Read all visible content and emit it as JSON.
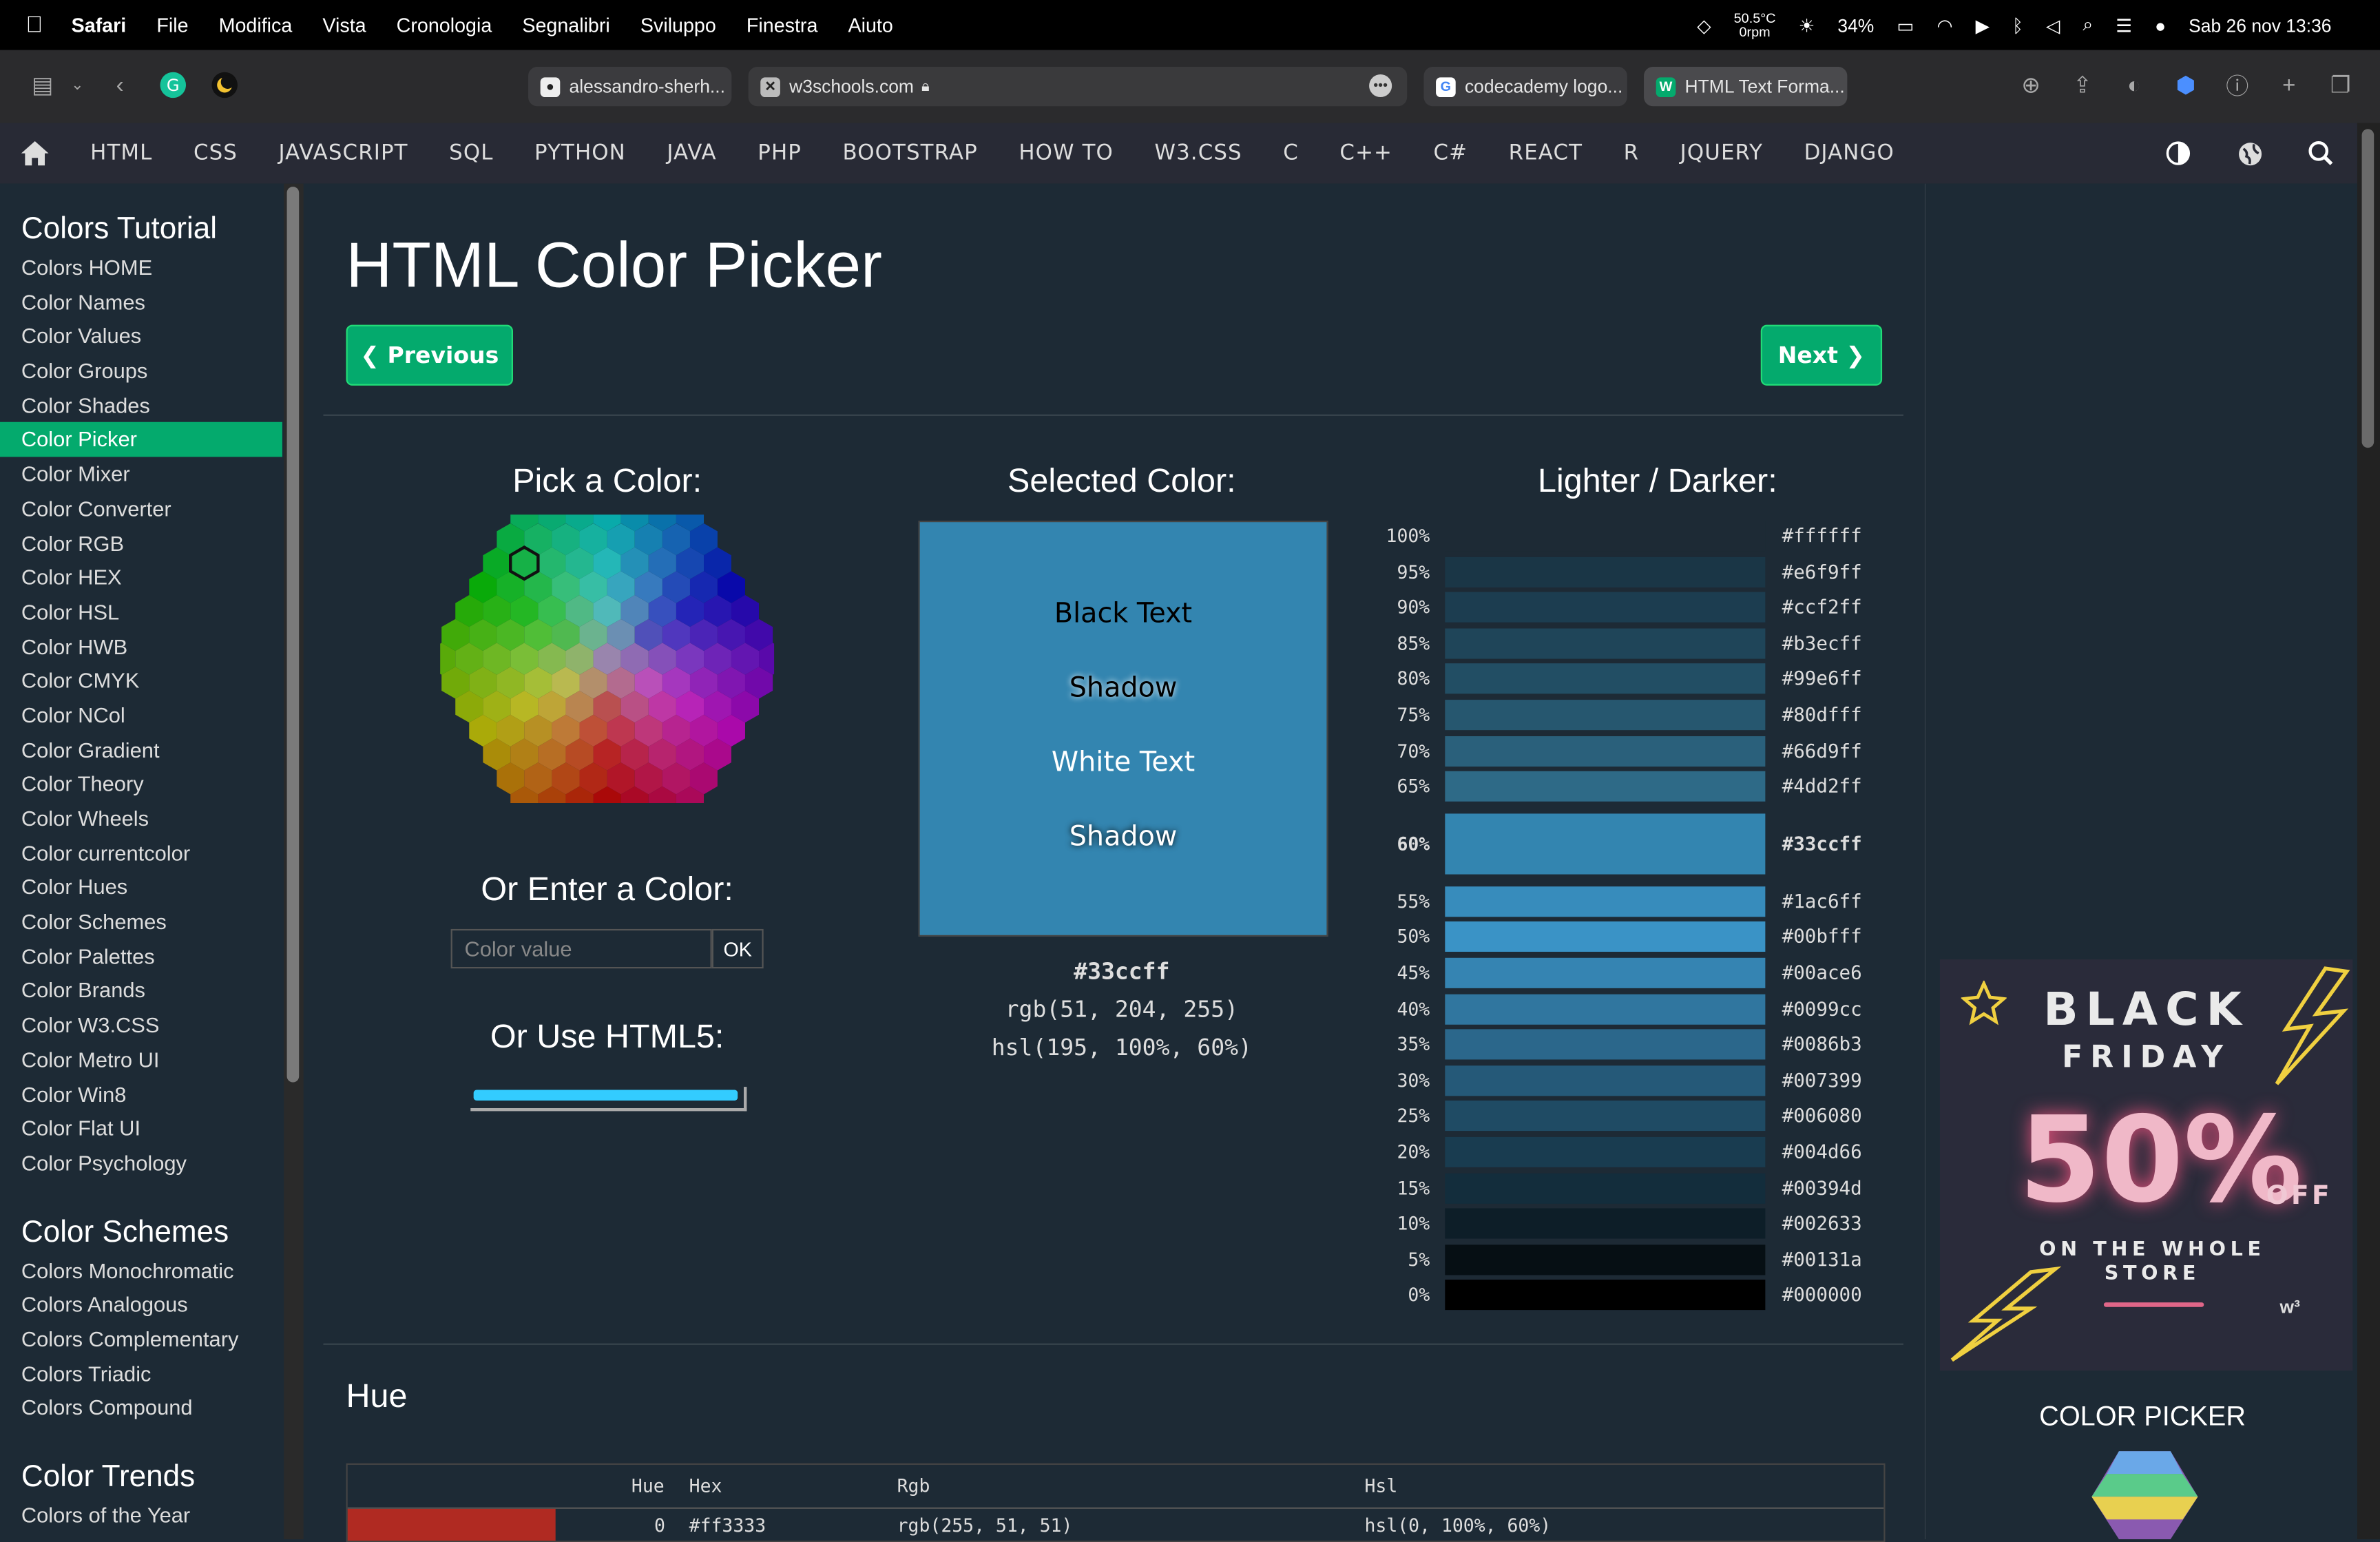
{
  "menubar": {
    "app": "Safari",
    "items": [
      "File",
      "Modifica",
      "Vista",
      "Cronologia",
      "Segnalibri",
      "Sviluppo",
      "Finestra",
      "Aiuto"
    ],
    "temp": "50.5°C",
    "rpm": "0rpm",
    "battery": "34%",
    "datetime": "Sab 26 nov  13:36"
  },
  "browser": {
    "tabs": [
      {
        "label": "alessandro-sherh..."
      },
      {
        "label": "w3schools.com"
      },
      {
        "label": "codecademy logo..."
      },
      {
        "label": "HTML Text Forma..."
      }
    ]
  },
  "nav": {
    "items": [
      "HTML",
      "CSS",
      "JAVASCRIPT",
      "SQL",
      "PYTHON",
      "JAVA",
      "PHP",
      "BOOTSTRAP",
      "HOW TO",
      "W3.CSS",
      "C",
      "C++",
      "C#",
      "REACT",
      "R",
      "JQUERY",
      "DJANGO"
    ]
  },
  "sidebar": {
    "section1": "Colors Tutorial",
    "items1": [
      "Colors HOME",
      "Color Names",
      "Color Values",
      "Color Groups",
      "Color Shades",
      "Color Picker",
      "Color Mixer",
      "Color Converter",
      "Color RGB",
      "Color HEX",
      "Color HSL",
      "Color HWB",
      "Color CMYK",
      "Color NCol",
      "Color Gradient",
      "Color Theory",
      "Color Wheels",
      "Color currentcolor",
      "Color Hues",
      "Color Schemes",
      "Color Palettes",
      "Color Brands",
      "Color W3.CSS",
      "Color Metro UI",
      "Color Win8",
      "Color Flat UI",
      "Color Psychology"
    ],
    "active": "Color Picker",
    "section2": "Color Schemes",
    "items2": [
      "Colors Monochromatic",
      "Colors Analogous",
      "Colors Complementary",
      "Colors Triadic",
      "Colors Compound"
    ],
    "section3": "Color Trends",
    "items3": [
      "Colors of the Year"
    ]
  },
  "main": {
    "title": "HTML Color Picker",
    "prev": "❮ Previous",
    "next": "Next ❯",
    "pick_title": "Pick a Color:",
    "enter_title": "Or Enter a Color:",
    "input_placeholder": "Color value",
    "ok": "OK",
    "html5_title": "Or Use HTML5:",
    "selected_title": "Selected Color:",
    "selected": {
      "color": "#33ccff",
      "display_bg": "#3385b0",
      "black_text": "Black Text",
      "shadow1": "Shadow",
      "white_text": "White Text",
      "shadow2": "Shadow",
      "hex": "#33ccff",
      "rgb": "rgb(51, 204, 255)",
      "hsl": "hsl(195, 100%, 60%)"
    },
    "lighter_title": "Lighter / Darker:",
    "shades": [
      {
        "pct": "100%",
        "hex": "#ffffff",
        "swatch": "#1d2a35"
      },
      {
        "pct": "95%",
        "hex": "#e6f9ff",
        "swatch": "#1a3646"
      },
      {
        "pct": "90%",
        "hex": "#ccf2ff",
        "swatch": "#1c3d50"
      },
      {
        "pct": "85%",
        "hex": "#b3ecff",
        "swatch": "#1f4559"
      },
      {
        "pct": "80%",
        "hex": "#99e6ff",
        "swatch": "#224e64"
      },
      {
        "pct": "75%",
        "hex": "#80dfff",
        "swatch": "#26576f"
      },
      {
        "pct": "70%",
        "hex": "#66d9ff",
        "swatch": "#2a607b"
      },
      {
        "pct": "65%",
        "hex": "#4dd2ff",
        "swatch": "#2e6a87"
      },
      {
        "pct": "60%",
        "hex": "#33ccff",
        "swatch": "#3385b0",
        "selected": true
      },
      {
        "pct": "55%",
        "hex": "#1ac6ff",
        "swatch": "#378cbc"
      },
      {
        "pct": "50%",
        "hex": "#00bfff",
        "swatch": "#3a93c6"
      },
      {
        "pct": "45%",
        "hex": "#00ace6",
        "swatch": "#3584b2"
      },
      {
        "pct": "40%",
        "hex": "#0099cc",
        "swatch": "#30769f"
      },
      {
        "pct": "35%",
        "hex": "#0086b3",
        "swatch": "#2b678b"
      },
      {
        "pct": "30%",
        "hex": "#007399",
        "swatch": "#255978"
      },
      {
        "pct": "25%",
        "hex": "#006080",
        "swatch": "#1f4b64"
      },
      {
        "pct": "20%",
        "hex": "#004d66",
        "swatch": "#193c50"
      },
      {
        "pct": "15%",
        "hex": "#00394d",
        "swatch": "#132d3c"
      },
      {
        "pct": "10%",
        "hex": "#002633",
        "swatch": "#0d1e28"
      },
      {
        "pct": "5%",
        "hex": "#00131a",
        "swatch": "#060f14"
      },
      {
        "pct": "0%",
        "hex": "#000000",
        "swatch": "#000000"
      }
    ],
    "hue_title": "Hue",
    "hue_table": {
      "headers": [
        "Hue",
        "Hex",
        "Rgb",
        "Hsl"
      ],
      "row": {
        "hue": "0",
        "hex": "#ff3333",
        "rgb": "rgb(255, 51, 51)",
        "hsl": "hsl(0, 100%, 60%)"
      }
    }
  },
  "rail": {
    "ad": {
      "line1": "BLACK",
      "line2": "FRIDAY",
      "big": "50%",
      "off": "OFF",
      "store": "ON THE WHOLE STORE"
    },
    "cp_title": "COLOR PICKER"
  }
}
